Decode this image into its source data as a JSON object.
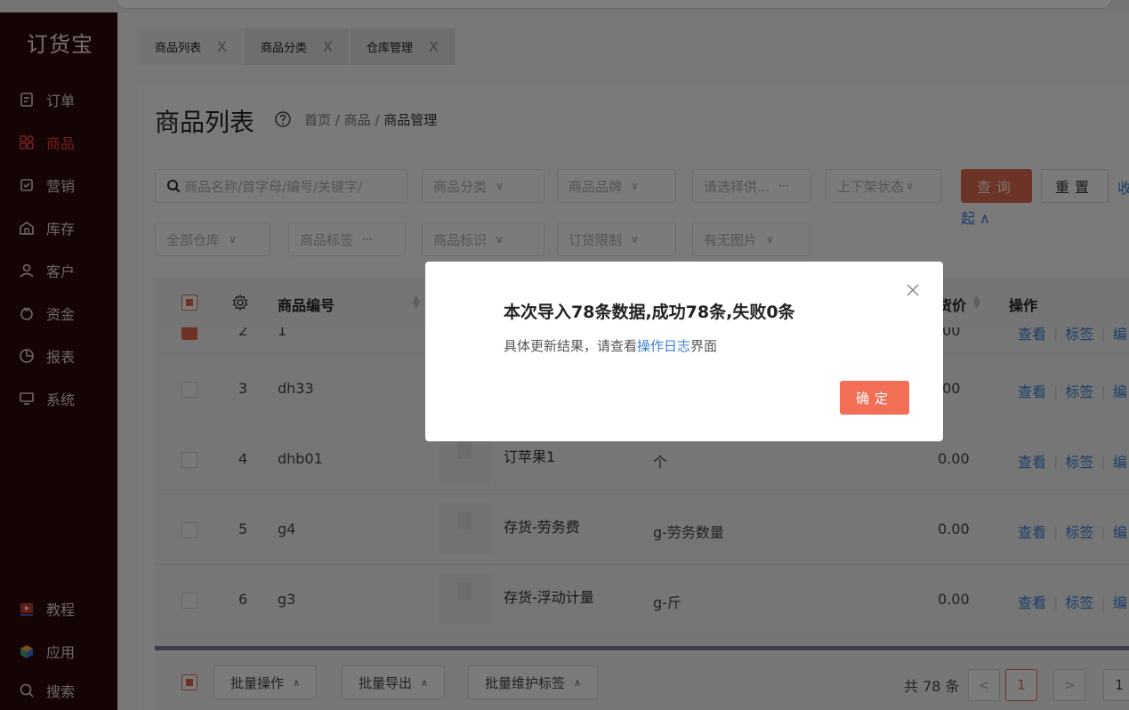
{
  "sidebar": {
    "logo": "订货宝",
    "items": [
      {
        "label": "订单",
        "icon": "order-icon"
      },
      {
        "label": "商品",
        "icon": "goods-icon",
        "active": true
      },
      {
        "label": "营销",
        "icon": "marketing-icon"
      },
      {
        "label": "库存",
        "icon": "inventory-icon"
      },
      {
        "label": "客户",
        "icon": "customer-icon"
      },
      {
        "label": "资金",
        "icon": "funds-icon"
      },
      {
        "label": "报表",
        "icon": "report-icon"
      },
      {
        "label": "系统",
        "icon": "system-icon"
      }
    ],
    "bottom_items": [
      {
        "label": "教程",
        "icon": "tutorial-icon"
      },
      {
        "label": "应用",
        "icon": "apps-icon"
      },
      {
        "label": "搜索",
        "icon": "search-icon"
      }
    ]
  },
  "tabs": [
    {
      "label": "商品列表",
      "close": "X"
    },
    {
      "label": "商品分类",
      "close": "X"
    },
    {
      "label": "仓库管理",
      "close": "X"
    }
  ],
  "page": {
    "title": "商品列表",
    "breadcrumb": {
      "home": "首页",
      "sep": "/",
      "level2": "商品",
      "current": "商品管理"
    }
  },
  "filters": {
    "search_placeholder": "商品名称/首字母/编号/关键字/",
    "category": "商品分类",
    "brand": "商品品牌",
    "supplier": "请选择供...",
    "shelf_status": "上下架状态",
    "warehouse": "全部仓库",
    "tags": "商品标签",
    "identifier": "商品标识",
    "order_limit": "订货限制",
    "has_image": "有无图片",
    "query_label": "查询",
    "reset_label": "重置",
    "collapse_label": "收",
    "collapse_label2": "起 ∧",
    "more_glyph": "···",
    "chevron_glyph": "∨"
  },
  "table": {
    "columns": {
      "code": "商品编号",
      "price": "货价",
      "ops": "操作"
    },
    "partial_row": {
      "num": "2",
      "code": "1",
      "price": ".00",
      "ops": [
        "查看",
        "标签",
        "编"
      ]
    },
    "rows": [
      {
        "num": "3",
        "code": "dh33",
        "name": "",
        "unit": "",
        "price": ".00",
        "ops": [
          "查看",
          "标签",
          "编"
        ]
      },
      {
        "num": "4",
        "code": "dhb01",
        "name": "订苹果1",
        "unit": "个",
        "price": "0.00",
        "ops": [
          "查看",
          "标签",
          "编"
        ]
      },
      {
        "num": "5",
        "code": "g4",
        "name": "存货-劳务费",
        "unit": "g-劳务数量",
        "price": "0.00",
        "ops": [
          "查看",
          "标签",
          "编"
        ]
      },
      {
        "num": "6",
        "code": "g3",
        "name": "存货-浮动计量",
        "unit": "g-斤",
        "price": "0.00",
        "ops": [
          "查看",
          "标签",
          "编"
        ]
      }
    ]
  },
  "footer": {
    "batch_ops": "批量操作",
    "batch_export": "批量导出",
    "batch_tags": "批量维护标签",
    "chevron_up": "∧",
    "total": "共 78 条",
    "prev": "<",
    "current_page": "1",
    "next": ">",
    "jump_partial": "1"
  },
  "modal": {
    "title": "本次导入78条数据,成功78条,失败0条",
    "body_prefix": "具体更新结果，请查看",
    "body_link": "操作日志",
    "body_suffix": "界面",
    "ok_label": "确定"
  },
  "colors": {
    "sidebar_bg": "#290808",
    "accent": "#f26e54",
    "link": "#3b7fd1"
  }
}
